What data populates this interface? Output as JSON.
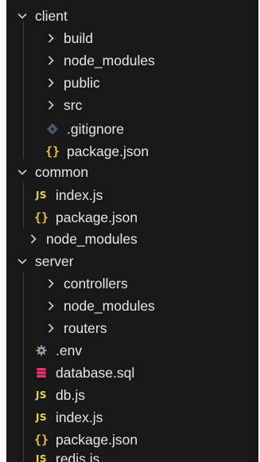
{
  "explorer": {
    "items": [
      {
        "label": "client",
        "type": "folder",
        "expanded": true
      },
      {
        "label": "build",
        "type": "folder",
        "expanded": false
      },
      {
        "label": "node_modules",
        "type": "folder",
        "expanded": false
      },
      {
        "label": "public",
        "type": "folder",
        "expanded": false
      },
      {
        "label": "src",
        "type": "folder",
        "expanded": false
      },
      {
        "label": ".gitignore",
        "type": "file",
        "icon": "git-icon"
      },
      {
        "label": "package.json",
        "type": "file",
        "icon": "json-icon",
        "icon_text": "{}"
      },
      {
        "label": "common",
        "type": "folder",
        "expanded": true
      },
      {
        "label": "index.js",
        "type": "file",
        "icon": "js-icon",
        "icon_text": "JS"
      },
      {
        "label": "package.json",
        "type": "file",
        "icon": "json-icon",
        "icon_text": "{}"
      },
      {
        "label": "node_modules",
        "type": "folder",
        "expanded": false
      },
      {
        "label": "server",
        "type": "folder",
        "expanded": true
      },
      {
        "label": "controllers",
        "type": "folder",
        "expanded": false
      },
      {
        "label": "node_modules",
        "type": "folder",
        "expanded": false
      },
      {
        "label": "routers",
        "type": "folder",
        "expanded": false
      },
      {
        "label": ".env",
        "type": "file",
        "icon": "gear-icon"
      },
      {
        "label": "database.sql",
        "type": "file",
        "icon": "database-icon"
      },
      {
        "label": "db.js",
        "type": "file",
        "icon": "js-icon",
        "icon_text": "JS"
      },
      {
        "label": "index.js",
        "type": "file",
        "icon": "js-icon",
        "icon_text": "JS"
      },
      {
        "label": "package.json",
        "type": "file",
        "icon": "json-icon",
        "icon_text": "{}"
      },
      {
        "label": "redis.js",
        "type": "file",
        "icon": "js-icon",
        "icon_text": "JS"
      }
    ]
  },
  "colors": {
    "background": "#181818",
    "text": "#e6e6e6",
    "chevron": "#d0d0d0",
    "js_icon": "#e8d44d",
    "json_icon": "#f1c232",
    "git_icon": "#4a5a6e",
    "gear_icon": "#8f9aa6",
    "database_icon": "#e8336b",
    "indent_guide": "#3f3f3f"
  }
}
